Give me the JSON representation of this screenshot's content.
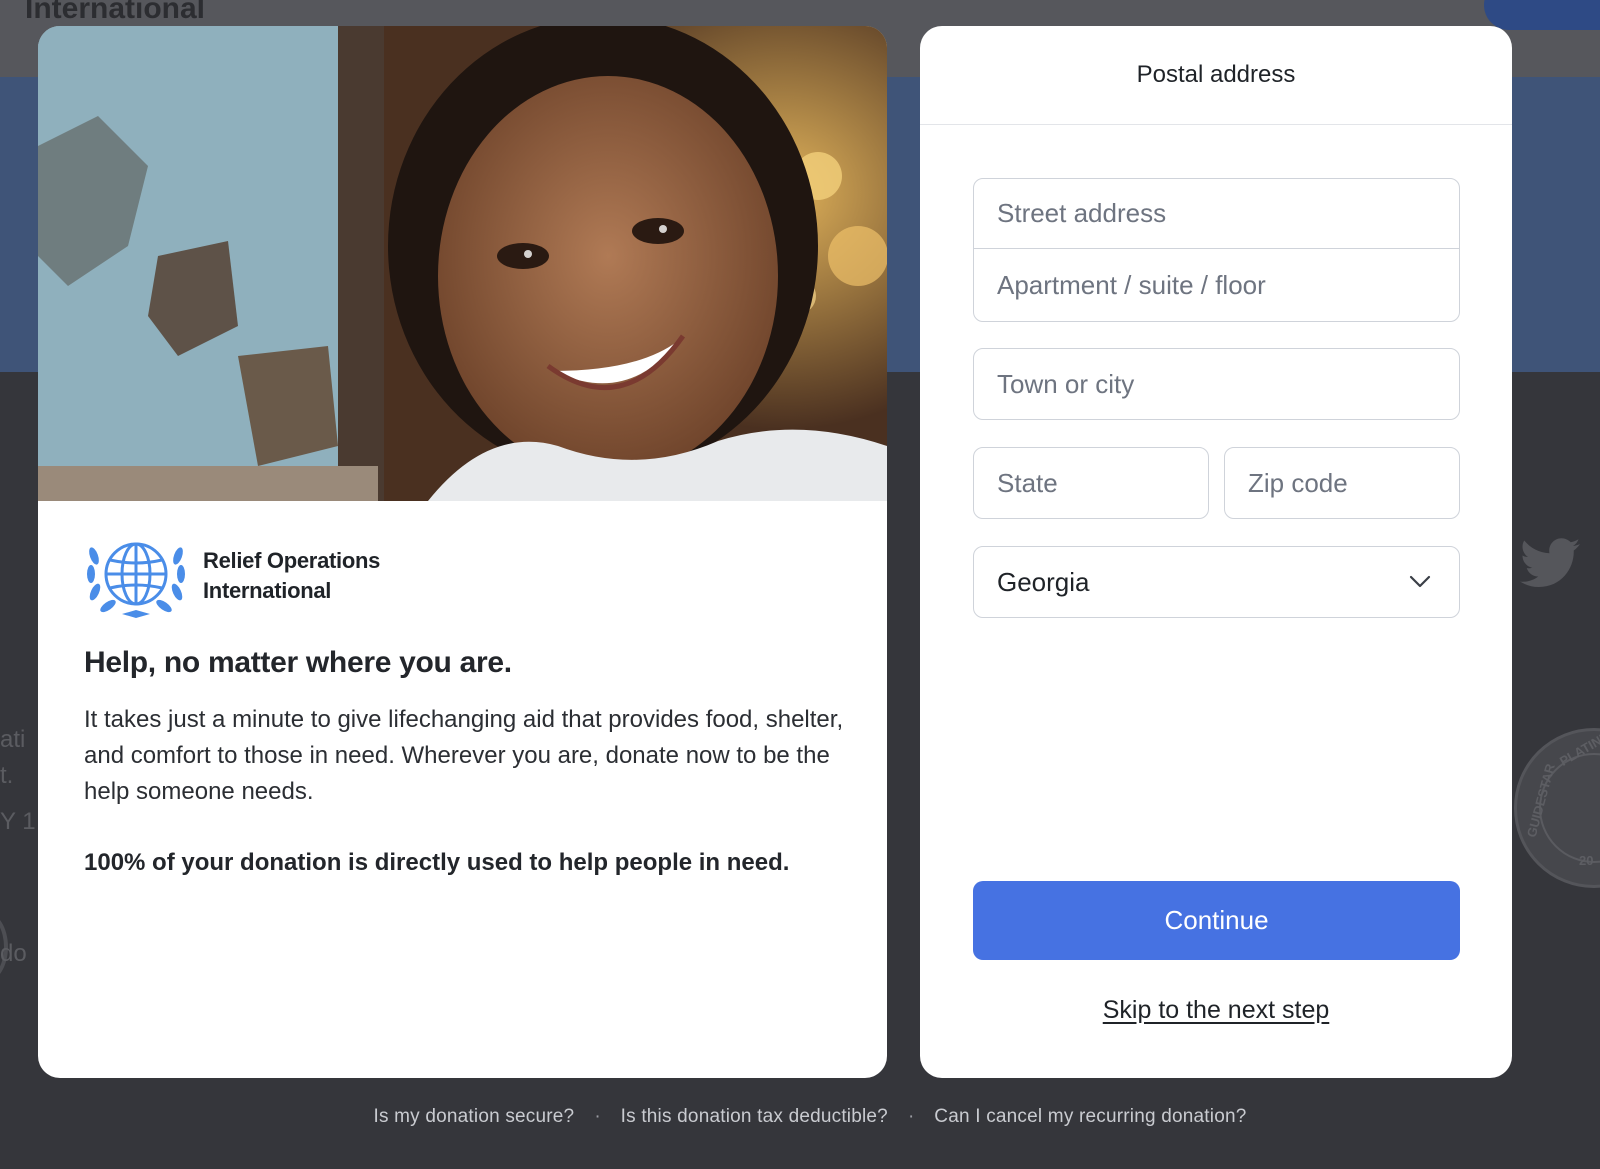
{
  "background": {
    "header_title": "International",
    "fragments": [
      "ati",
      "t.",
      "Y 1",
      "do"
    ],
    "seal_top": "PLATINU",
    "seal_side": "GUIDESTAR",
    "seal_year": "20"
  },
  "info": {
    "org_name": "Relief Operations International",
    "headline": "Help, no matter where you are.",
    "body": "It takes just a minute to give lifechanging aid that provides food, shelter, and comfort to those in need. Wherever you are, donate now to be the help someone needs.",
    "highlight": "100% of your donation is directly used to help people in need."
  },
  "form": {
    "title": "Postal address",
    "street_placeholder": "Street address",
    "apartment_placeholder": "Apartment / suite / floor",
    "city_placeholder": "Town or city",
    "state_placeholder": "State",
    "zip_placeholder": "Zip code",
    "country_value": "Georgia",
    "continue_label": "Continue",
    "skip_label": "Skip to the next step"
  },
  "faq": {
    "secure": "Is my donation secure?",
    "tax": "Is this donation tax deductible?",
    "cancel": "Can I cancel my recurring donation?",
    "separator": "·"
  },
  "colors": {
    "primary": "#4672e2",
    "logo_blue": "#4a8de8",
    "overlay": "#3b3c41"
  },
  "icons": {
    "logo": "globe-wreath-icon",
    "select": "chevron-down-icon",
    "social": "twitter-bird-icon"
  }
}
